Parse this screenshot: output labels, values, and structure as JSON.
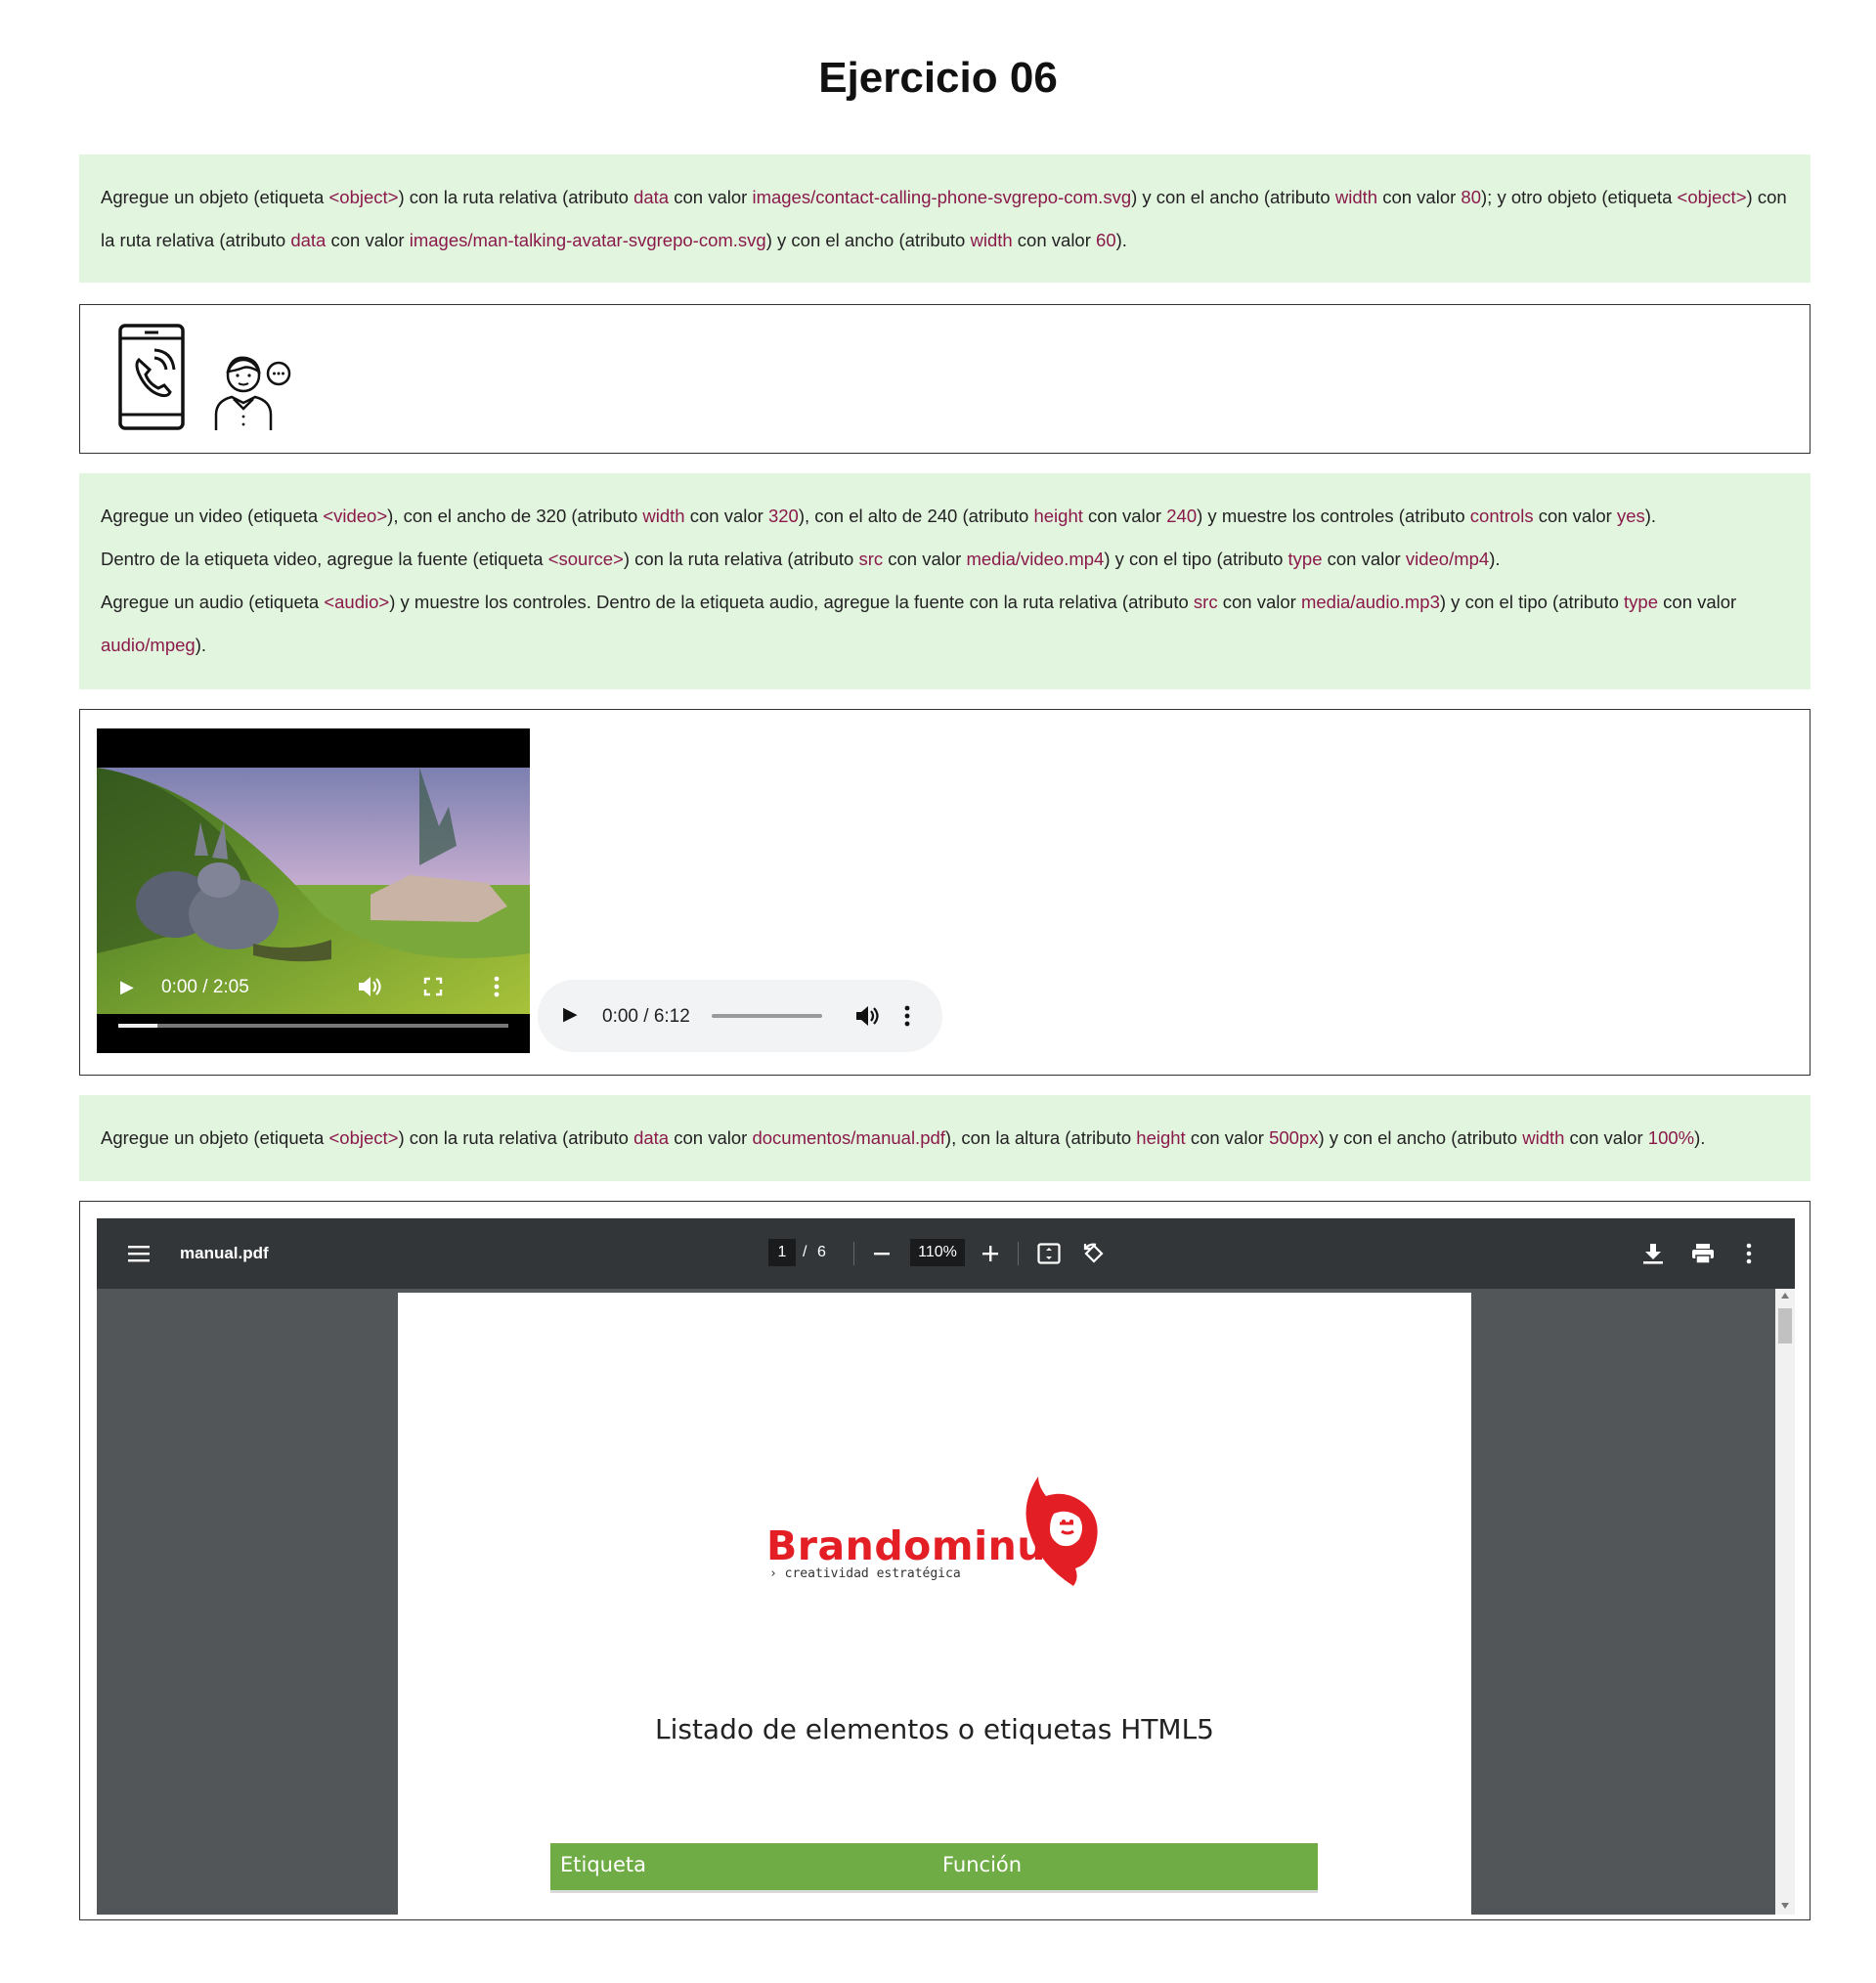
{
  "title": "Ejercicio 06",
  "section1": {
    "s1": "Agregue un objeto (etiqueta ",
    "k1": "<object>",
    "s2": ") con la ruta relativa (atributo ",
    "k2": "data",
    "s3": " con valor ",
    "k3": "images/contact-calling-phone-svgrepo-com.svg",
    "s4": ") y con el ancho (atributo ",
    "k4": "width",
    "s5": " con valor ",
    "k5": "80",
    "s6": "); y otro objeto (etiqueta ",
    "k6": "<object>",
    "s7": ") con la ruta relativa (atributo ",
    "k7": "data",
    "s8": " con valor ",
    "k8": "images/man-talking-avatar-svgrepo-com.svg",
    "s9": ") y con el ancho (atributo ",
    "k9": "width",
    "s10": " con valor ",
    "k10": "60",
    "s11": ")."
  },
  "icons": {
    "phone": "phone-calling-icon",
    "avatar": "man-talking-avatar-icon"
  },
  "section2": {
    "l1": {
      "s1": "Agregue un video (etiqueta ",
      "k1": "<video>",
      "s2": "), con el ancho de 320 (atributo ",
      "k2": "width",
      "s3": " con valor ",
      "k3": "320",
      "s4": "), con el alto de 240 (atributo ",
      "k4": "height",
      "s5": " con valor ",
      "k5": "240",
      "s6": ") y muestre los controles (atributo ",
      "k6": "controls",
      "s7": " con valor ",
      "k7": "yes",
      "s8": ")."
    },
    "l2": {
      "s1": "Dentro de la etiqueta video, agregue la fuente (etiqueta ",
      "k1": "<source>",
      "s2": ") con la ruta relativa (atributo ",
      "k2": "src",
      "s3": " con valor ",
      "k3": "media/video.mp4",
      "s4": ") y con el tipo (atributo ",
      "k4": "type",
      "s5": " con valor ",
      "k5": "video/mp4",
      "s6": ")."
    },
    "l3": {
      "s1": "Agregue un audio (etiqueta ",
      "k1": "<audio>",
      "s2": ") y muestre los controles. Dentro de la etiqueta audio, agregue la fuente con la ruta relativa (atributo ",
      "k2": "src",
      "s3": " con valor ",
      "k3": "media/audio.mp3",
      "s4": ") y con el tipo (atributo ",
      "k4": "type",
      "s5": " con valor ",
      "k5": "audio/mpeg",
      "s6": ")."
    }
  },
  "video": {
    "time": "0:00 / 2:05",
    "progress": 0.1
  },
  "audio": {
    "time": "0:00 / 6:12"
  },
  "section3": {
    "s1": "Agregue un objeto (etiqueta ",
    "k1": "<object>",
    "s2": ") con la ruta relativa (atributo ",
    "k2": "data",
    "s3": " con valor ",
    "k3": "documentos/manual.pdf",
    "s4": "), con la altura (atributo ",
    "k4": "height",
    "s5": " con valor ",
    "k5": "500px",
    "s6": ") y con el ancho (atributo ",
    "k6": "width",
    "s7": " con valor ",
    "k7": "100%",
    "s8": ")."
  },
  "pdf": {
    "filename": "manual.pdf",
    "page": "1",
    "total": "6",
    "zoom": "110%",
    "logo_text": "Brandominus",
    "logo_tagline": "› creatividad estratégica",
    "doc_title": "Listado de elementos o etiquetas HTML5",
    "col1": "Etiqueta",
    "col2": "Función"
  },
  "colors": {
    "keyword": "#8b1a4a",
    "green_bg": "#e2f5df",
    "table_header": "#6fac46",
    "brand_red": "#e31e24"
  }
}
